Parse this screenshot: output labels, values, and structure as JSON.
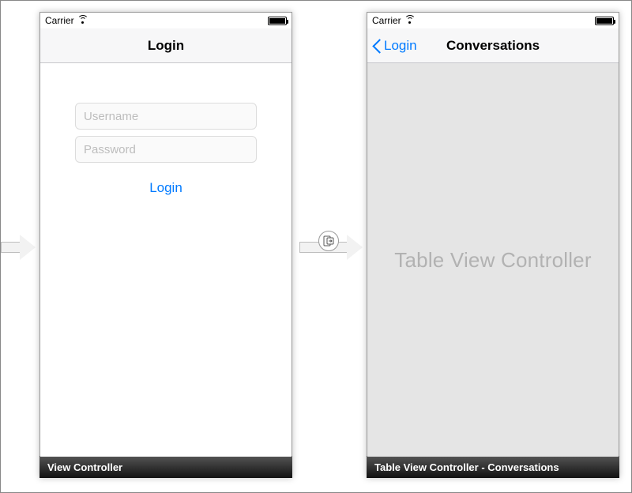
{
  "statusbar": {
    "carrier": "Carrier"
  },
  "login_scene": {
    "nav_title": "Login",
    "username_placeholder": "Username",
    "password_placeholder": "Password",
    "login_button": "Login",
    "caption": "View Controller"
  },
  "conversations_scene": {
    "back_label": "Login",
    "nav_title": "Conversations",
    "placeholder_text": "Table View Controller",
    "caption": "Table View Controller - Conversations"
  }
}
